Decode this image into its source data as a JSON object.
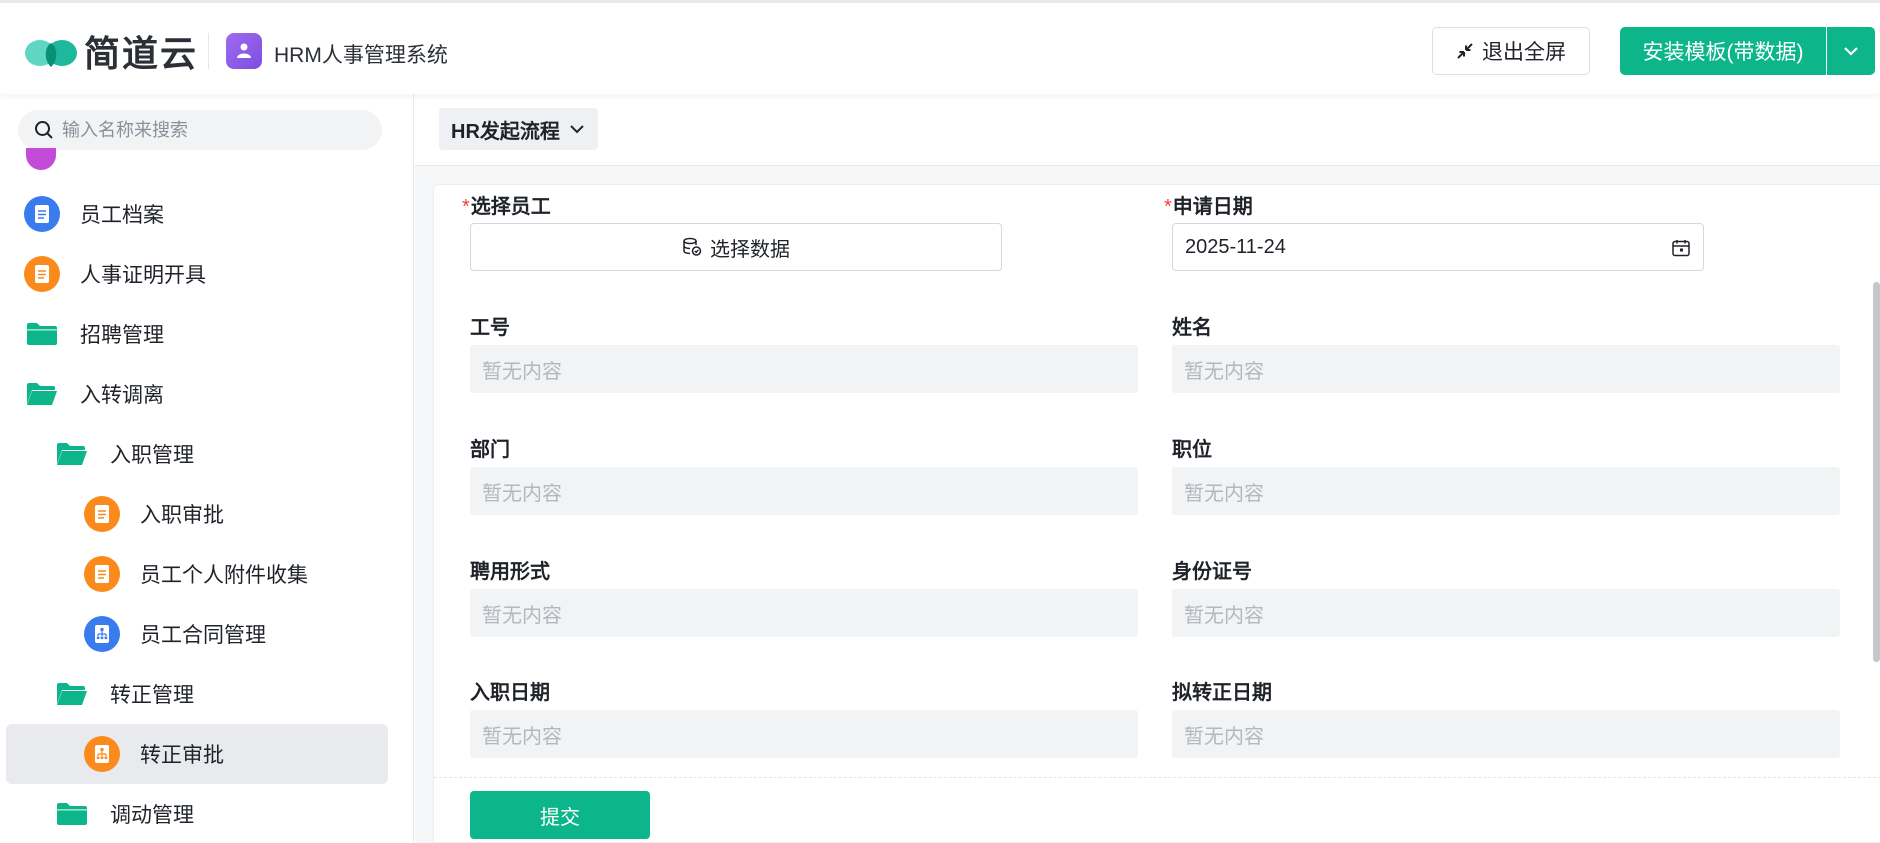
{
  "header": {
    "brand": "简道云",
    "app_title": "HRM人事管理系统",
    "exit_fullscreen_label": "退出全屏",
    "install_label": "安装模板(带数据)"
  },
  "sidebar": {
    "search_placeholder": "输入名称来搜索",
    "items": [
      {
        "label": "员工档案"
      },
      {
        "label": "人事证明开具"
      },
      {
        "label": "招聘管理"
      },
      {
        "label": "入转调离"
      },
      {
        "label": "入职管理"
      },
      {
        "label": "入职审批"
      },
      {
        "label": "员工个人附件收集"
      },
      {
        "label": "员工合同管理"
      },
      {
        "label": "转正管理"
      },
      {
        "label": "转正审批"
      },
      {
        "label": "调动管理"
      }
    ]
  },
  "main": {
    "flow_label": "HR发起流程",
    "form": {
      "select_employee_label": "选择员工",
      "select_data_label": "选择数据",
      "apply_date_label": "申请日期",
      "apply_date_value": "2025-11-24",
      "empty_text": "暂无内容",
      "fields": [
        {
          "label": "工号"
        },
        {
          "label": "姓名"
        },
        {
          "label": "部门"
        },
        {
          "label": "职位"
        },
        {
          "label": "聘用形式"
        },
        {
          "label": "身份证号"
        },
        {
          "label": "入职日期"
        },
        {
          "label": "拟转正日期"
        }
      ],
      "submit_label": "提交"
    }
  },
  "colors": {
    "primary": "#0db58a",
    "required": "#f0413a",
    "active_bg": "#e9eaee"
  }
}
